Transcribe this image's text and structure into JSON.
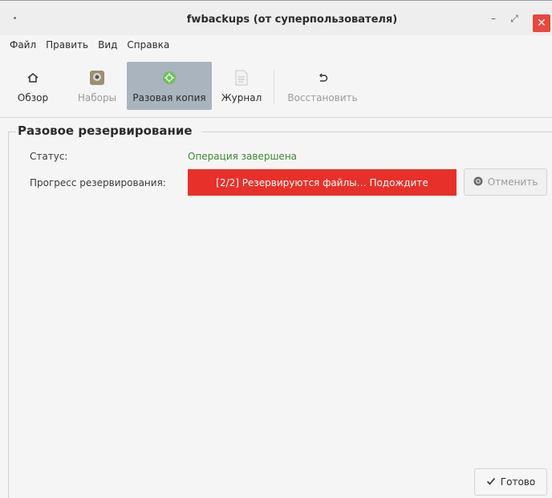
{
  "window": {
    "title": "fwbackups (от суперпользователя)",
    "min_glyph": "–",
    "max_glyph": "⤢",
    "close_glyph": "✕"
  },
  "menu": [
    "Файл",
    "Править",
    "Вид",
    "Справка"
  ],
  "toolbar": {
    "overview": "Обзор",
    "sets": "Наборы",
    "onetime": "Разовая копия",
    "log": "Журнал",
    "restore": "Восстановить"
  },
  "section": {
    "title": "Разовое резервирование",
    "status_label": "Статус:",
    "status_value": "Операция завершена",
    "progress_label": "Прогресс резервирования:",
    "progress_text": "[2/2] Резервируются файлы… Подождите",
    "cancel_label": "Отменить",
    "done_label": "Готово"
  },
  "colors": {
    "accent_active": "#a9b4be",
    "status_ok": "#3c8a2e",
    "progress": "#e8302a",
    "close": "#e8483e"
  },
  "icons": {
    "overview": "home-icon",
    "sets": "sets-icon",
    "onetime": "backup-icon",
    "log": "log-icon",
    "restore": "undo-icon",
    "cancel": "cancel-icon",
    "done": "check-icon"
  }
}
